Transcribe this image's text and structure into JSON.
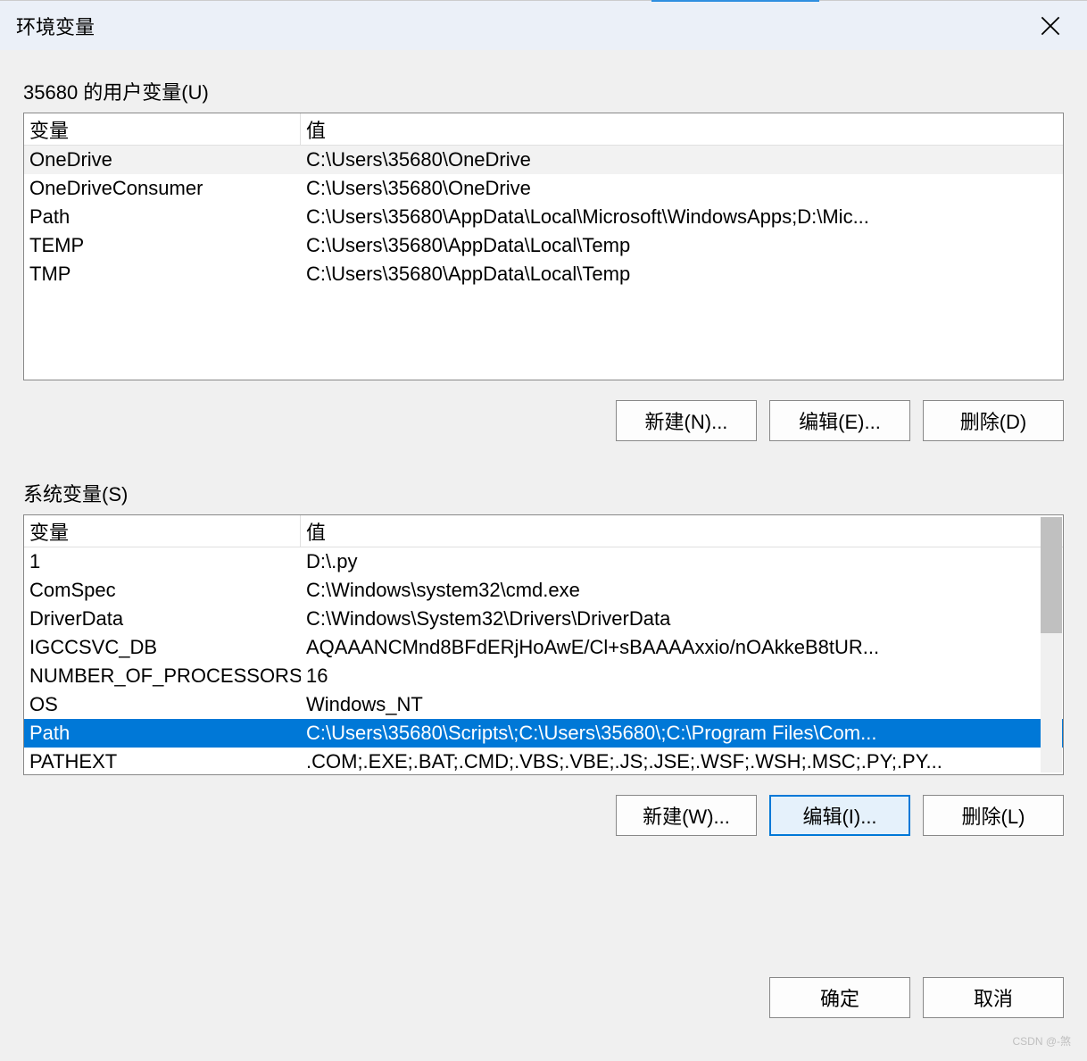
{
  "title": "环境变量",
  "userSection": {
    "label": "35680 的用户变量(U)",
    "headers": {
      "var": "变量",
      "val": "值"
    },
    "rows": [
      {
        "var": "OneDrive",
        "val": "C:\\Users\\35680\\OneDrive",
        "shaded": true
      },
      {
        "var": "OneDriveConsumer",
        "val": "C:\\Users\\35680\\OneDrive"
      },
      {
        "var": "Path",
        "val": "C:\\Users\\35680\\AppData\\Local\\Microsoft\\WindowsApps;D:\\Mic..."
      },
      {
        "var": "TEMP",
        "val": "C:\\Users\\35680\\AppData\\Local\\Temp"
      },
      {
        "var": "TMP",
        "val": "C:\\Users\\35680\\AppData\\Local\\Temp"
      }
    ],
    "buttons": {
      "new": "新建(N)...",
      "edit": "编辑(E)...",
      "del": "删除(D)"
    }
  },
  "systemSection": {
    "label": "系统变量(S)",
    "headers": {
      "var": "变量",
      "val": "值"
    },
    "rows": [
      {
        "var": "1",
        "val": "D:\\.py"
      },
      {
        "var": "ComSpec",
        "val": "C:\\Windows\\system32\\cmd.exe"
      },
      {
        "var": "DriverData",
        "val": "C:\\Windows\\System32\\Drivers\\DriverData"
      },
      {
        "var": "IGCCSVC_DB",
        "val": "AQAAANCMnd8BFdERjHoAwE/Cl+sBAAAAxxio/nOAkkeB8tUR..."
      },
      {
        "var": "NUMBER_OF_PROCESSORS",
        "val": "16"
      },
      {
        "var": "OS",
        "val": "Windows_NT"
      },
      {
        "var": "Path",
        "val": "C:\\Users\\35680\\Scripts\\;C:\\Users\\35680\\;C:\\Program Files\\Com...",
        "selected": true
      },
      {
        "var": "PATHEXT",
        "val": ".COM;.EXE;.BAT;.CMD;.VBS;.VBE;.JS;.JSE;.WSF;.WSH;.MSC;.PY;.PY..."
      }
    ],
    "buttons": {
      "new": "新建(W)...",
      "edit": "编辑(I)...",
      "del": "删除(L)"
    }
  },
  "dialogButtons": {
    "ok": "确定",
    "cancel": "取消"
  },
  "watermark": "CSDN @-煞"
}
